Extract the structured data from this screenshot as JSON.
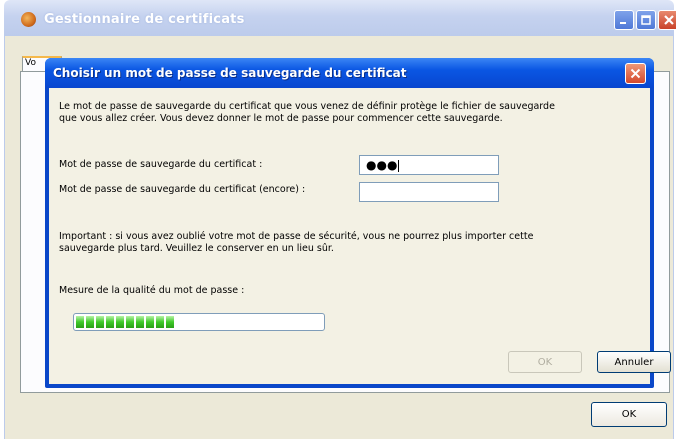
{
  "outer_window": {
    "title": "Gestionnaire de certificats",
    "tab_label": "Vo",
    "ok_label": "OK"
  },
  "dialog": {
    "title": "Choisir un mot de passe de sauvegarde du certificat",
    "intro_line1": "Le mot de passe de sauvegarde du certificat que vous venez de définir protège le fichier de sauvegarde",
    "intro_line2": "que vous allez créer. Vous devez donner le mot de passe pour commencer cette sauvegarde.",
    "password_label": "Mot de passe de sauvegarde du certificat :",
    "password_value": "●●●",
    "confirm_label": "Mot de passe de sauvegarde du certificat (encore) :",
    "confirm_value": "",
    "important_line1": "Important : si vous avez oublié votre mot de passe de sécurité, vous ne pourrez plus importer cette",
    "important_line2": "sauvegarde plus tard. Veuillez le conserver en un lieu sûr.",
    "quality_label": "Mesure de la qualité du mot de passe :",
    "quality_fraction": 0.4,
    "ok_label": "OK",
    "cancel_label": "Annuler"
  },
  "colors": {
    "dialog_title_bg": "#0a56e3",
    "meter_fill": "#3fc92a",
    "close_red": "#d4492c"
  }
}
